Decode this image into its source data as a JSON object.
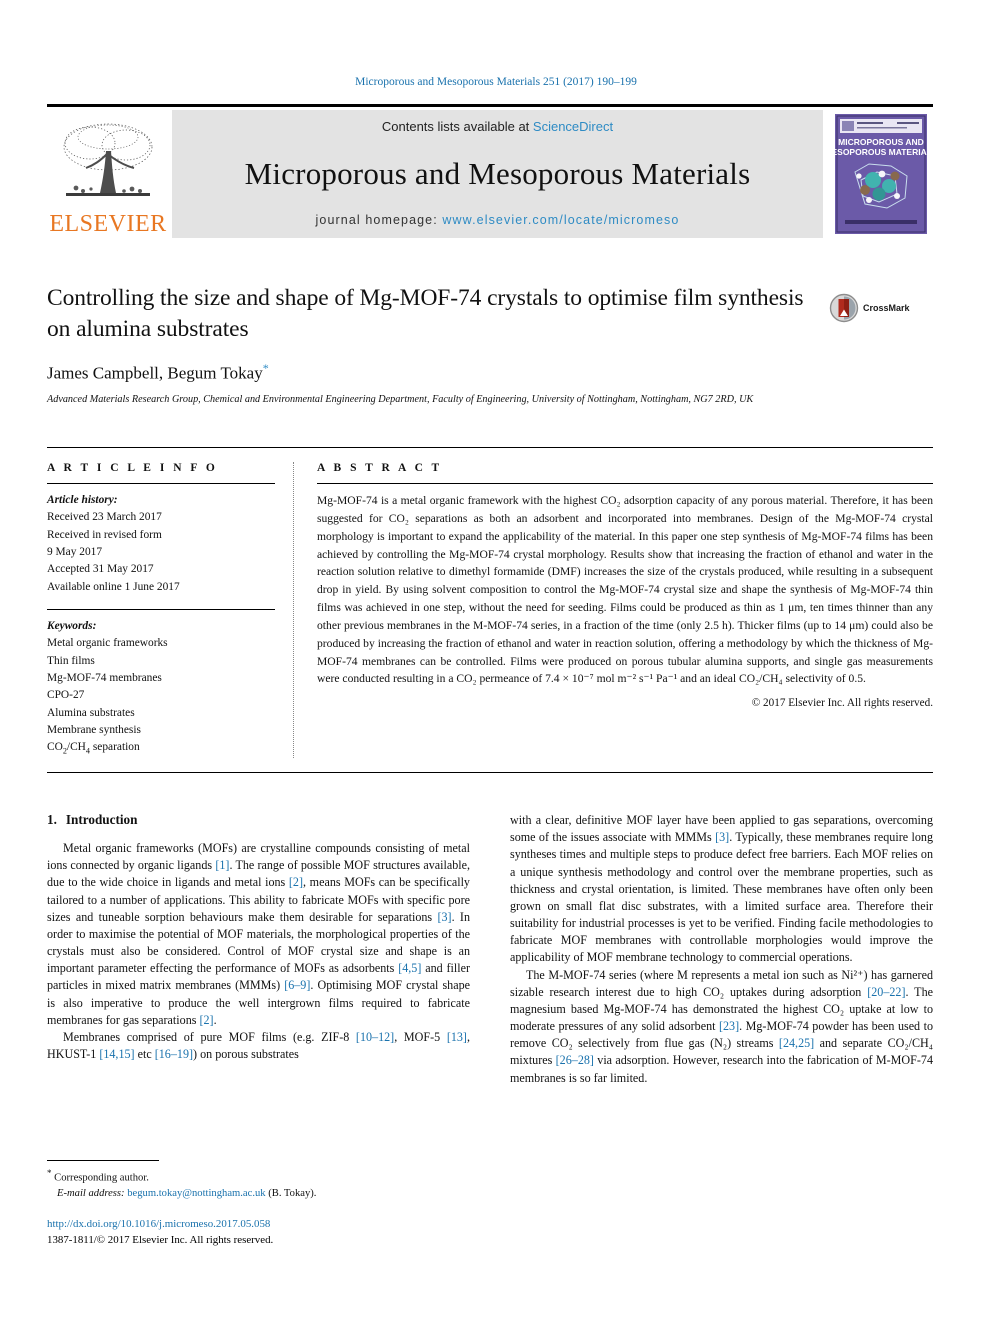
{
  "running_head": "Microporous and Mesoporous Materials 251 (2017) 190–199",
  "masthead": {
    "publisher_name": "ELSEVIER",
    "contents_prefix": "Contents lists available at ",
    "contents_link": "ScienceDirect",
    "journal_name": "Microporous and Mesoporous Materials",
    "homepage_prefix": "journal homepage: ",
    "homepage_url": "www.elsevier.com/locate/micromeso",
    "cover_title_line1": "MICROPOROUS AND",
    "cover_title_line2": "MESOPOROUS MATERIALS"
  },
  "article": {
    "title": "Controlling the size and shape of Mg-MOF-74 crystals to optimise film synthesis on alumina substrates",
    "authors": "James Campbell, Begum Tokay",
    "corresponding_marker": "*",
    "affiliation": "Advanced Materials Research Group, Chemical and Environmental Engineering Department, Faculty of Engineering, University of Nottingham, Nottingham, NG7 2RD, UK",
    "crossmark_label": "CrossMark"
  },
  "article_info": {
    "heading": "A R T I C L E   I N F O",
    "history_label": "Article history:",
    "history": [
      "Received 23 March 2017",
      "Received in revised form",
      "9 May 2017",
      "Accepted 31 May 2017",
      "Available online 1 June 2017"
    ],
    "keywords_label": "Keywords:",
    "keywords": [
      "Metal organic frameworks",
      "Thin films",
      "Mg-MOF-74 membranes",
      "CPO-27",
      "Alumina substrates",
      "Membrane synthesis",
      "CO2/CH4 separation"
    ]
  },
  "abstract": {
    "heading": "A B S T R A C T",
    "text": "Mg-MOF-74 is a metal organic framework with the highest CO₂ adsorption capacity of any porous material. Therefore, it has been suggested for CO₂ separations as both an adsorbent and incorporated into membranes. Design of the Mg-MOF-74 crystal morphology is important to expand the applicability of the material. In this paper one step synthesis of Mg-MOF-74 films has been achieved by controlling the Mg-MOF-74 crystal morphology. Results show that increasing the fraction of ethanol and water in the reaction solution relative to dimethyl formamide (DMF) increases the size of the crystals produced, while resulting in a subsequent drop in yield. By using solvent composition to control the Mg-MOF-74 crystal size and shape the synthesis of Mg-MOF-74 thin films was achieved in one step, without the need for seeding. Films could be produced as thin as 1 μm, ten times thinner than any other previous membranes in the M-MOF-74 series, in a fraction of the time (only 2.5 h). Thicker films (up to 14 μm) could also be produced by increasing the fraction of ethanol and water in reaction solution, offering a methodology by which the thickness of Mg-MOF-74 membranes can be controlled. Films were produced on porous tubular alumina supports, and single gas measurements were conducted resulting in a CO₂ permeance of 7.4 × 10⁻⁷ mol m⁻² s⁻¹ Pa⁻¹ and an ideal CO₂/CH₄ selectivity of 0.5.",
    "copyright": "© 2017 Elsevier Inc. All rights reserved."
  },
  "introduction": {
    "number": "1.",
    "title": "Introduction",
    "left_paragraphs": [
      "Metal organic frameworks (MOFs) are crystalline compounds consisting of metal ions connected by organic ligands [1]. The range of possible MOF structures available, due to the wide choice in ligands and metal ions [2], means MOFs can be specifically tailored to a number of applications. This ability to fabricate MOFs with specific pore sizes and tuneable sorption behaviours make them desirable for separations [3]. In order to maximise the potential of MOF materials, the morphological properties of the crystals must also be considered. Control of MOF crystal size and shape is an important parameter effecting the performance of MOFs as adsorbents [4,5] and filler particles in mixed matrix membranes (MMMs) [6–9]. Optimising MOF crystal shape is also imperative to produce the well intergrown films required to fabricate membranes for gas separations [2].",
      "Membranes comprised of pure MOF films (e.g. ZIF-8 [10–12], MOF-5 [13], HKUST-1 [14,15] etc [16–19]) on porous substrates"
    ],
    "right_paragraphs": [
      "with a clear, definitive MOF layer have been applied to gas separations, overcoming some of the issues associate with MMMs [3]. Typically, these membranes require long syntheses times and multiple steps to produce defect free barriers. Each MOF relies on a unique synthesis methodology and control over the membrane properties, such as thickness and crystal orientation, is limited. These membranes have often only been grown on small flat disc substrates, with a limited surface area. Therefore their suitability for industrial processes is yet to be verified. Finding facile methodologies to fabricate MOF membranes with controllable morphologies would improve the applicability of MOF membrane technology to commercial operations.",
      "The M-MOF-74 series (where M represents a metal ion such as Ni²⁺) has garnered sizable research interest due to high CO₂ uptakes during adsorption [20–22]. The magnesium based Mg-MOF-74 has demonstrated the highest CO₂ uptake at low to moderate pressures of any solid adsorbent [23]. Mg-MOF-74 powder has been used to remove CO₂ selectively from flue gas (N₂) streams [24,25] and separate CO₂/CH₄ mixtures [26–28] via adsorption. However, research into the fabrication of M-MOF-74 membranes is so far limited."
    ]
  },
  "footnote": {
    "star": "*",
    "corresponding": "Corresponding author.",
    "email_label": "E-mail address:",
    "email": "begum.tokay@nottingham.ac.uk",
    "email_suffix": "(B. Tokay)."
  },
  "footer": {
    "doi": "http://dx.doi.org/10.1016/j.micromeso.2017.05.058",
    "issn_line": "1387-1811/© 2017 Elsevier Inc. All rights reserved."
  },
  "colors": {
    "link_blue": "#1a72ad",
    "sciencedirect_blue": "#2e8bc4",
    "elsevier_orange": "#e87722",
    "cover_purple": "#5b4a9e"
  }
}
